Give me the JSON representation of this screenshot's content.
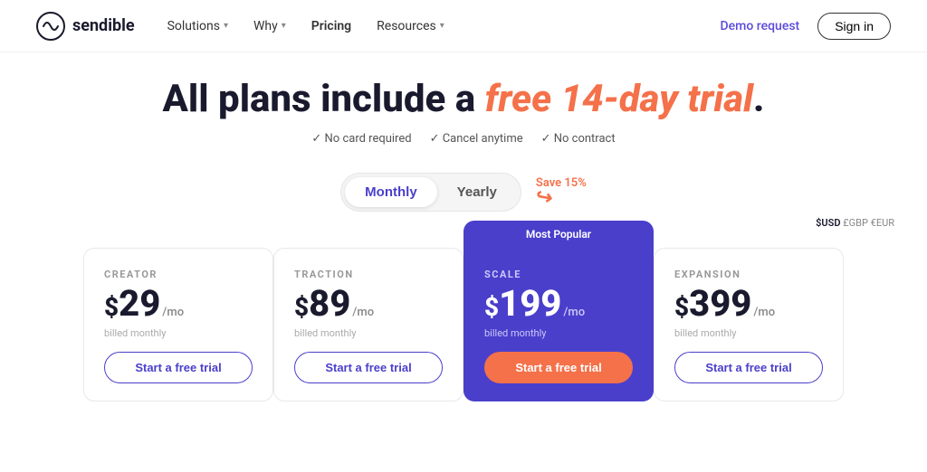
{
  "nav": {
    "logo_text": "sendible",
    "links": [
      {
        "label": "Solutions",
        "has_dropdown": true
      },
      {
        "label": "Why",
        "has_dropdown": true
      },
      {
        "label": "Pricing",
        "has_dropdown": false,
        "active": true
      },
      {
        "label": "Resources",
        "has_dropdown": true
      }
    ],
    "demo_label": "Demo request",
    "signin_label": "Sign in"
  },
  "hero": {
    "headline_part1": "All plans include a ",
    "headline_highlight": "free 14-day trial",
    "headline_part2": ".",
    "perks": [
      "No card required",
      "Cancel anytime",
      "No contract"
    ]
  },
  "billing": {
    "monthly_label": "Monthly",
    "yearly_label": "Yearly",
    "save_label": "Save 15%",
    "active": "monthly"
  },
  "currency": {
    "usd": "$USD",
    "gbp": "£GBP",
    "eur": "€EUR"
  },
  "plans": [
    {
      "name": "CREATOR",
      "price": "29",
      "per": "/mo",
      "billed": "billed monthly",
      "cta": "Start a free trial",
      "popular": false
    },
    {
      "name": "TRACTION",
      "price": "89",
      "per": "/mo",
      "billed": "billed monthly",
      "cta": "Start a free trial",
      "popular": false
    },
    {
      "name": "SCALE",
      "price": "199",
      "per": "/mo",
      "billed": "billed monthly",
      "cta": "Start a free trial",
      "popular": true,
      "popular_label": "Most Popular"
    },
    {
      "name": "EXPANSION",
      "price": "399",
      "per": "/mo",
      "billed": "billed monthly",
      "cta": "Start a free trial",
      "popular": false
    }
  ]
}
